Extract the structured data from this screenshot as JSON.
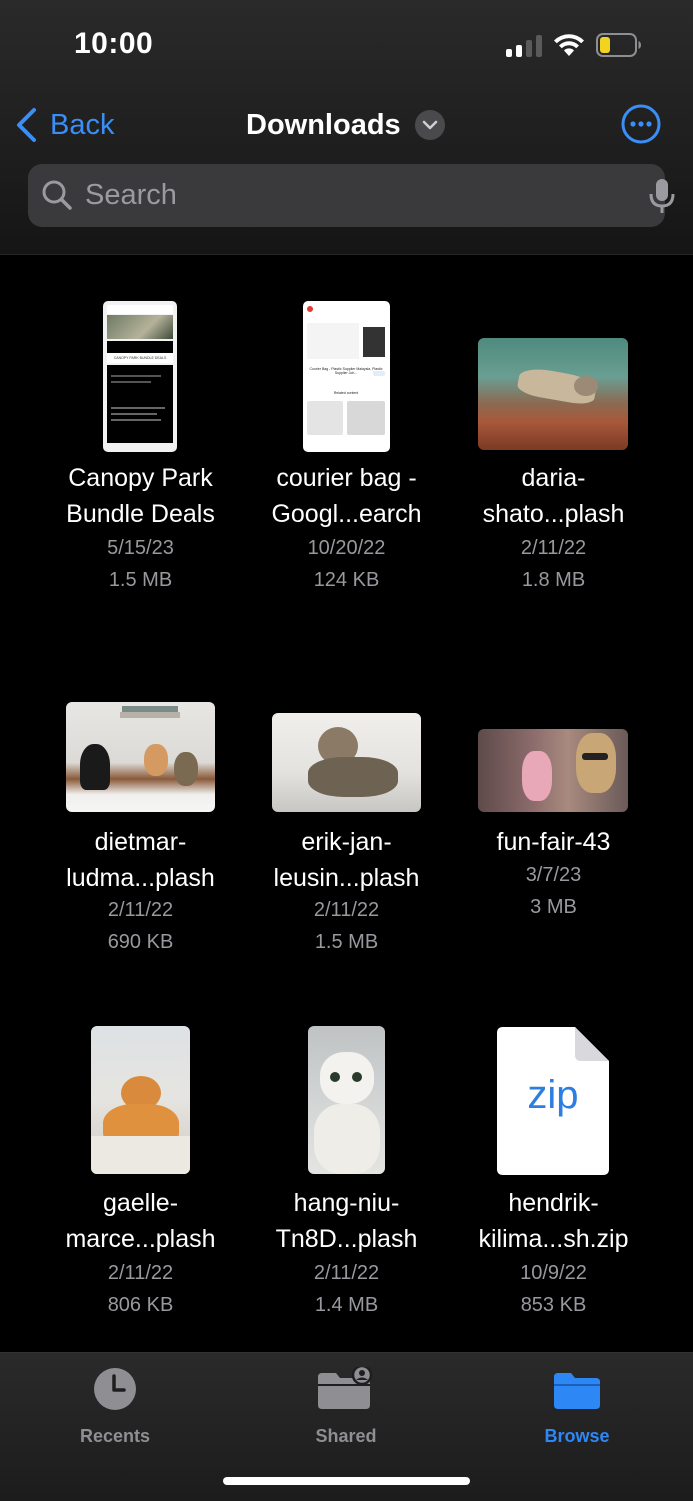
{
  "status": {
    "time": "10:00"
  },
  "nav": {
    "back_label": "Back",
    "title": "Downloads"
  },
  "search": {
    "placeholder": "Search"
  },
  "files": [
    {
      "name_line1": "Canopy Park",
      "name_line2": "Bundle Deals",
      "date": "5/15/23",
      "size": "1.5 MB"
    },
    {
      "name_line1": "courier bag -",
      "name_line2": "Googl...earch",
      "date": "10/20/22",
      "size": "124 KB"
    },
    {
      "name_line1": "daria-",
      "name_line2": "shato...plash",
      "date": "2/11/22",
      "size": "1.8 MB"
    },
    {
      "name_line1": "dietmar-",
      "name_line2": "ludma...plash",
      "date": "2/11/22",
      "size": "690 KB"
    },
    {
      "name_line1": "erik-jan-",
      "name_line2": "leusin...plash",
      "date": "2/11/22",
      "size": "1.5 MB"
    },
    {
      "name_line1": "fun-fair-43",
      "name_line2": "",
      "date": "3/7/23",
      "size": "3 MB"
    },
    {
      "name_line1": "gaelle-",
      "name_line2": "marce...plash",
      "date": "2/11/22",
      "size": "806 KB"
    },
    {
      "name_line1": "hang-niu-",
      "name_line2": "Tn8D...plash",
      "date": "2/11/22",
      "size": "1.4 MB"
    },
    {
      "name_line1": "hendrik-",
      "name_line2": "kilima...sh.zip",
      "date": "10/9/22",
      "size": "853 KB"
    }
  ],
  "thumb_text": {
    "canopy_banner": "CANOPY PARK BUNDLE DEALS",
    "courier_heading": "Courier Bag - Plastic Supplier Malaysia, Plastic Supplier Joh...",
    "courier_related": "Related content",
    "zip_label": "zip"
  },
  "tabs": {
    "recents": "Recents",
    "shared": "Shared",
    "browse": "Browse"
  },
  "colors": {
    "accent": "#2d87f5",
    "inactive": "#8e8e93",
    "battery_fill": "#f2d321"
  }
}
